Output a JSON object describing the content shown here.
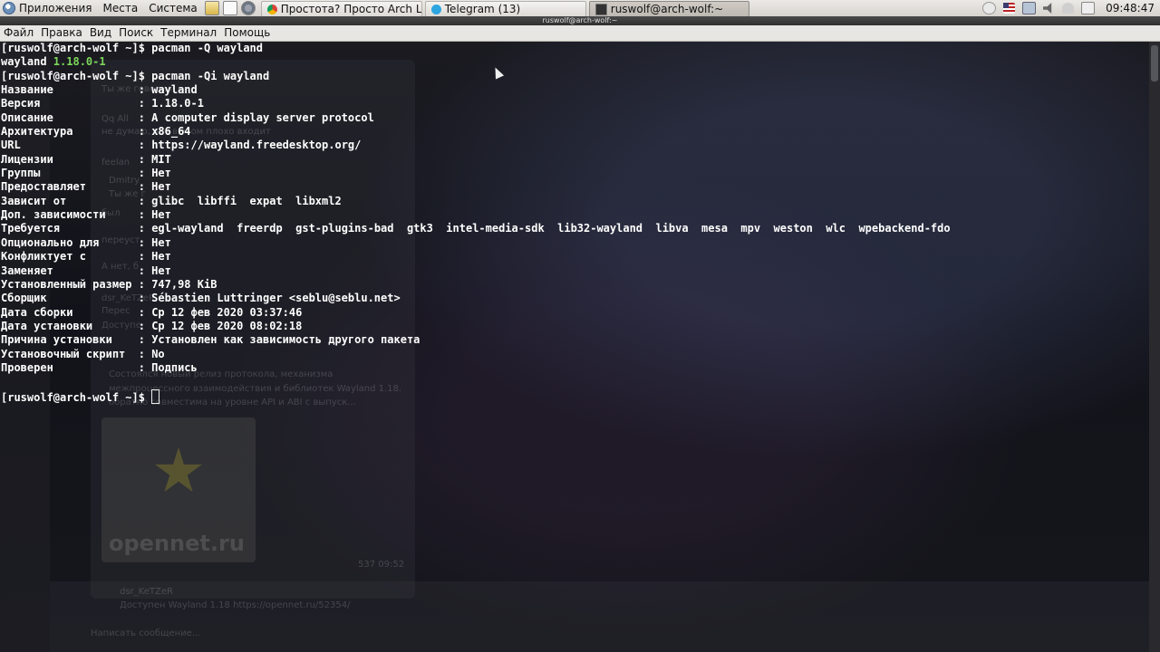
{
  "panel": {
    "menus": [
      "Приложения",
      "Места",
      "Система"
    ],
    "tasks": [
      {
        "label": "Простота? Просто Arch L...",
        "icon": "chrome-icon"
      },
      {
        "label": "Telegram (13)",
        "icon": "telegram-icon"
      },
      {
        "label": "ruswolf@arch-wolf:~",
        "icon": "terminal-icon"
      }
    ],
    "clock": "09:48:47"
  },
  "window": {
    "title": "ruswolf@arch-wolf:~",
    "menu": [
      "Файл",
      "Правка",
      "Вид",
      "Поиск",
      "Терминал",
      "Помощь"
    ]
  },
  "terminal": {
    "prompt": "[ruswolf@arch-wolf ~]$ ",
    "cmd1": "pacman -Q wayland",
    "out1_name": "wayland ",
    "out1_version": "1.18.0-1",
    "cmd2": "pacman -Qi wayland",
    "info": [
      {
        "key": "Название",
        "value": "wayland"
      },
      {
        "key": "Версия",
        "value": "1.18.0-1"
      },
      {
        "key": "Описание",
        "value": "A computer display server protocol"
      },
      {
        "key": "Архитектура",
        "value": "x86_64"
      },
      {
        "key": "URL",
        "value": "https://wayland.freedesktop.org/"
      },
      {
        "key": "Лицензии",
        "value": "MIT"
      },
      {
        "key": "Группы",
        "value": "Нет"
      },
      {
        "key": "Предоставляет",
        "value": "Нет"
      },
      {
        "key": "Зависит от",
        "value": "glibc  libffi  expat  libxml2"
      },
      {
        "key": "Доп. зависимости",
        "value": "Нет"
      },
      {
        "key": "Требуется",
        "value": "egl-wayland  freerdp  gst-plugins-bad  gtk3  intel-media-sdk  lib32-wayland  libva  mesa  mpv  weston  wlc  wpebackend-fdo"
      },
      {
        "key": "Опционально для",
        "value": "Нет"
      },
      {
        "key": "Конфликтует с",
        "value": "Нет"
      },
      {
        "key": "Заменяет",
        "value": "Нет"
      },
      {
        "key": "Установленный размер",
        "value": "747,98 KiB"
      },
      {
        "key": "Сборщик",
        "value": "Sébastien Luttringer <seblu@seblu.net>"
      },
      {
        "key": "Дата сборки",
        "value": "Ср 12 фев 2020 03:37:46"
      },
      {
        "key": "Дата установки",
        "value": "Ср 12 фев 2020 08:02:18"
      },
      {
        "key": "Причина установки",
        "value": "Установлен как зависимость другого пакета"
      },
      {
        "key": "Установочный скрипт",
        "value": "No"
      },
      {
        "key": "Проверен",
        "value": "Подпись"
      }
    ]
  },
  "background": {
    "ghost_texts": [
      "Ты же говорил",
      "Qq All",
      "не думаю, что в этом плохо входит",
      "feelan",
      "Dmitry",
      "Ты же г",
      "был",
      "переуст",
      "А нет, б",
      "dsr_KeTZeR",
      "Перес",
      "Доступе",
      "Состоялся новый релиз протокола, механизма",
      "межпроцессного взаимодействия и библиотек Wayland 1.18.",
      "обратно совместима на уровне API и ABI с выпуск...",
      "opennet.ru",
      "537 09:52",
      "dsr_KeTZeR",
      "Доступен Wayland 1.18 https://opennet.ru/52354/",
      "Написать сообщение..."
    ]
  }
}
